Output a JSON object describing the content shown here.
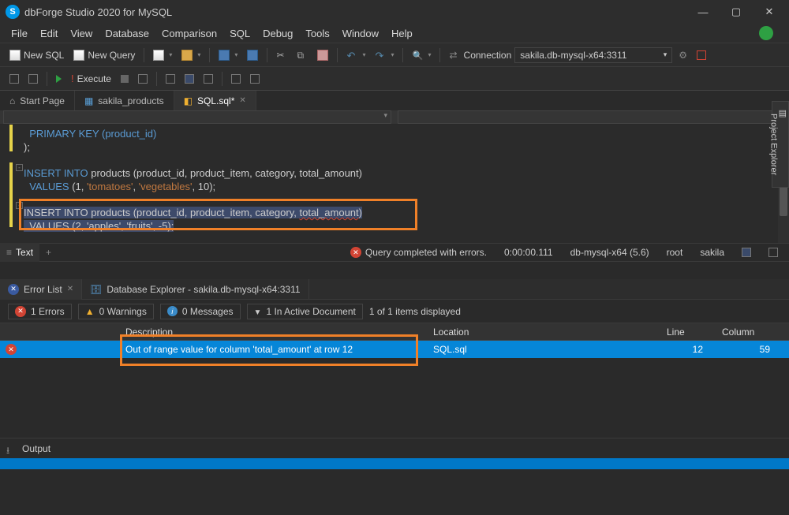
{
  "app": {
    "title": "dbForge Studio 2020 for MySQL"
  },
  "menu": {
    "file": "File",
    "edit": "Edit",
    "view": "View",
    "database": "Database",
    "comparison": "Comparison",
    "sql": "SQL",
    "debug": "Debug",
    "tools": "Tools",
    "window": "Window",
    "help": "Help"
  },
  "toolbar": {
    "newSql": "New SQL",
    "newQuery": "New Query",
    "execute": "Execute",
    "connectionLabel": "Connection",
    "connectionValue": "sakila.db-mysql-x64:3311"
  },
  "docTabs": {
    "start": "Start Page",
    "sakila": "sakila_products",
    "sql": "SQL.sql*"
  },
  "editor": {
    "line1": "  PRIMARY KEY (product_id)",
    "line2": ");",
    "line3a": "INSERT INTO",
    "line3b": " products (product_id, product_item, category, total_amount)",
    "line4a": "  VALUES ",
    "line4b": "(",
    "line4c": "1, ",
    "line4d": "'tomatoes'",
    "line4e": ", ",
    "line4f": "'vegetables'",
    "line4g": ", 10);",
    "line5a": "INSERT INTO products (product_id, product_item, category, ",
    "line5b": "total_amount",
    "line5c": ")",
    "line6": "  VALUES (2, 'apples', 'fruits', -5);"
  },
  "editorTabs": {
    "text": "Text"
  },
  "status": {
    "message": "Query completed with errors.",
    "elapsed": "0:00:00.111",
    "conn": "db-mysql-x64 (5.6)",
    "user": "root",
    "db": "sakila"
  },
  "panels": {
    "errorList": "Error List",
    "dbExplorer": "Database Explorer - sakila.db-mysql-x64:3311"
  },
  "filter": {
    "errors": "1 Errors",
    "warnings": "0 Warnings",
    "messages": "0 Messages",
    "active": "1 In Active Document",
    "count": "1 of 1 items displayed"
  },
  "grid": {
    "hDesc": "Description",
    "hLoc": "Location",
    "hLine": "Line",
    "hCol": "Column",
    "row": {
      "desc": "Out of range value for column 'total_amount' at row 12",
      "loc": "SQL.sql",
      "line": "12",
      "col": "59"
    }
  },
  "output": {
    "label": "Output"
  },
  "sidePanel": {
    "label": "Project Explorer"
  }
}
